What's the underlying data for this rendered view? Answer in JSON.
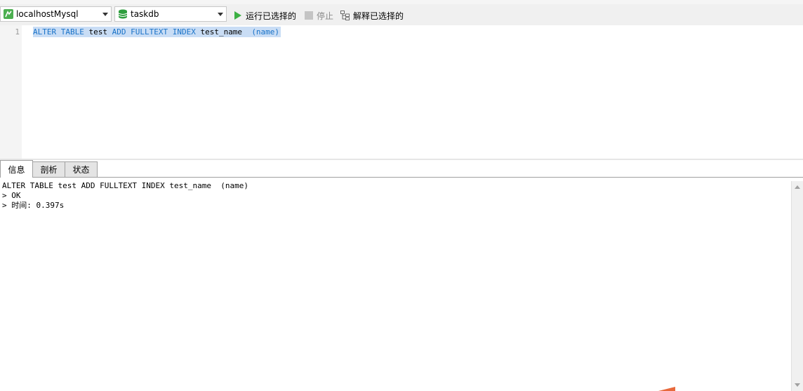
{
  "toolbar": {
    "connection": {
      "value": "localhostMysql",
      "icon": "mysql-connection-icon"
    },
    "database": {
      "value": "taskdb",
      "icon": "database-icon"
    },
    "run_selected_label": "运行已选择的",
    "stop_label": "停止",
    "explain_selected_label": "解释已选择的"
  },
  "editor": {
    "lines": [
      {
        "number": "1",
        "tokens": {
          "t1": "ALTER TABLE",
          "t2": "test",
          "t3": "ADD FULLTEXT INDEX",
          "t4": "test_name",
          "t5": "(name)"
        }
      }
    ]
  },
  "tabs": [
    {
      "label": "信息",
      "active": true
    },
    {
      "label": "剖析",
      "active": false
    },
    {
      "label": "状态",
      "active": false
    }
  ],
  "output": {
    "lines": [
      "ALTER TABLE test ADD FULLTEXT INDEX test_name  (name)",
      "> OK",
      "> 时间: 0.397s"
    ]
  },
  "colors": {
    "keyword": "#1a73c8",
    "selection": "#c9ddf5",
    "run_icon": "#3cb043",
    "database_icon": "#2e9e3e",
    "mysql_icon": "#4caf50"
  }
}
